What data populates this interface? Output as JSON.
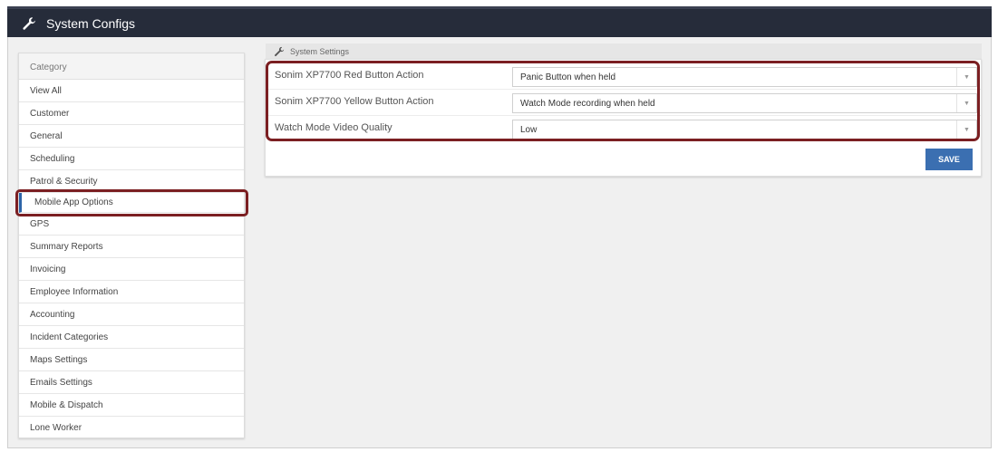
{
  "header": {
    "title": "System Configs",
    "icon": "wrench-icon"
  },
  "sidebar": {
    "category_label": "Category",
    "items": [
      {
        "label": "View All"
      },
      {
        "label": "Customer"
      },
      {
        "label": "General"
      },
      {
        "label": "Scheduling"
      },
      {
        "label": "Patrol & Security"
      },
      {
        "label": "Mobile App Options",
        "active": true
      },
      {
        "label": "GPS"
      },
      {
        "label": "Summary Reports"
      },
      {
        "label": "Invoicing"
      },
      {
        "label": "Employee Information"
      },
      {
        "label": "Accounting"
      },
      {
        "label": "Incident Categories"
      },
      {
        "label": "Maps Settings"
      },
      {
        "label": "Emails Settings"
      },
      {
        "label": "Mobile & Dispatch"
      },
      {
        "label": "Lone Worker"
      }
    ]
  },
  "settings": {
    "tab_label": "System Settings",
    "rows": [
      {
        "label": "Sonim XP7700 Red Button Action",
        "value": "Panic Button when held"
      },
      {
        "label": "Sonim XP7700 Yellow Button Action",
        "value": "Watch Mode recording when held"
      },
      {
        "label": "Watch Mode Video Quality",
        "value": "Low"
      }
    ],
    "save_label": "SAVE"
  },
  "colors": {
    "header_bg": "#262c3a",
    "accent": "#3b6fb1",
    "highlight": "#7b1f22"
  }
}
